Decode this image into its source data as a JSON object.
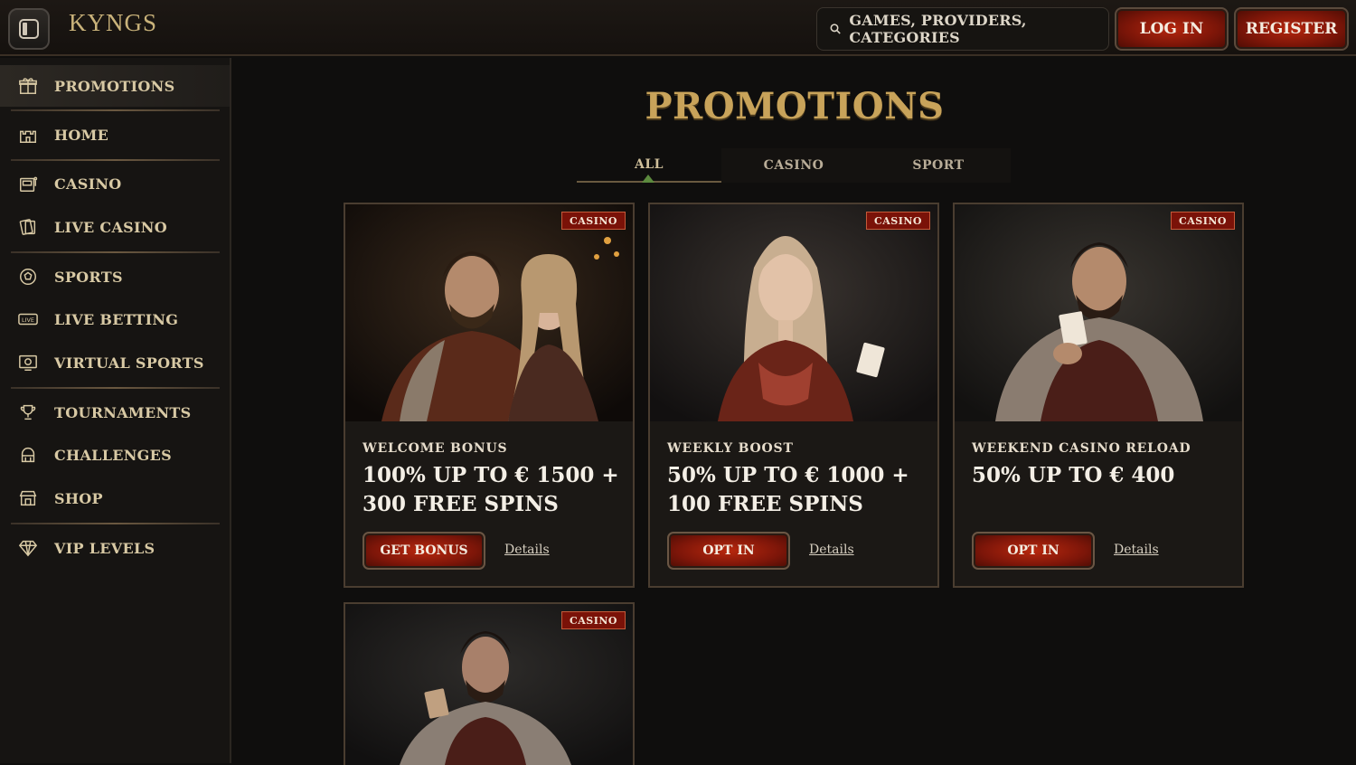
{
  "header": {
    "logo": "KYNGS",
    "search_placeholder": "GAMES, PROVIDERS, CATEGORIES",
    "login_label": "LOG IN",
    "register_label": "REGISTER"
  },
  "sidebar": {
    "items": [
      {
        "label": "PROMOTIONS",
        "icon": "gift-icon"
      },
      {
        "label": "HOME",
        "icon": "castle-icon"
      },
      {
        "label": "CASINO",
        "icon": "slot-machine-icon"
      },
      {
        "label": "LIVE CASINO",
        "icon": "cards-icon"
      },
      {
        "label": "SPORTS",
        "icon": "soccer-ball-icon"
      },
      {
        "label": "LIVE BETTING",
        "icon": "live-icon"
      },
      {
        "label": "VIRTUAL SPORTS",
        "icon": "virtual-screen-icon"
      },
      {
        "label": "TOURNAMENTS",
        "icon": "trophy-icon"
      },
      {
        "label": "CHALLENGES",
        "icon": "helmet-icon"
      },
      {
        "label": "SHOP",
        "icon": "shop-icon"
      },
      {
        "label": "VIP LEVELS",
        "icon": "diamond-icon"
      }
    ]
  },
  "main": {
    "title": "PROMOTIONS",
    "tabs": [
      "ALL",
      "CASINO",
      "SPORT"
    ],
    "active_tab": "ALL",
    "cards": [
      {
        "badge": "CASINO",
        "subtitle": "WELCOME BONUS",
        "title": "100% UP TO € 1500 + 300 FREE SPINS",
        "cta": "GET BONUS",
        "details": "Details"
      },
      {
        "badge": "CASINO",
        "subtitle": "WEEKLY BOOST",
        "title": "50% UP TO € 1000 + 100 FREE SPINS",
        "cta": "OPT IN",
        "details": "Details"
      },
      {
        "badge": "CASINO",
        "subtitle": "WEEKEND CASINO RELOAD",
        "title": "50% UP TO € 400",
        "cta": "OPT IN",
        "details": "Details"
      },
      {
        "badge": "CASINO"
      }
    ]
  },
  "colors": {
    "accent_gold": "#c8a35a",
    "button_red": "#b5260e",
    "background": "#0f0e0d"
  }
}
